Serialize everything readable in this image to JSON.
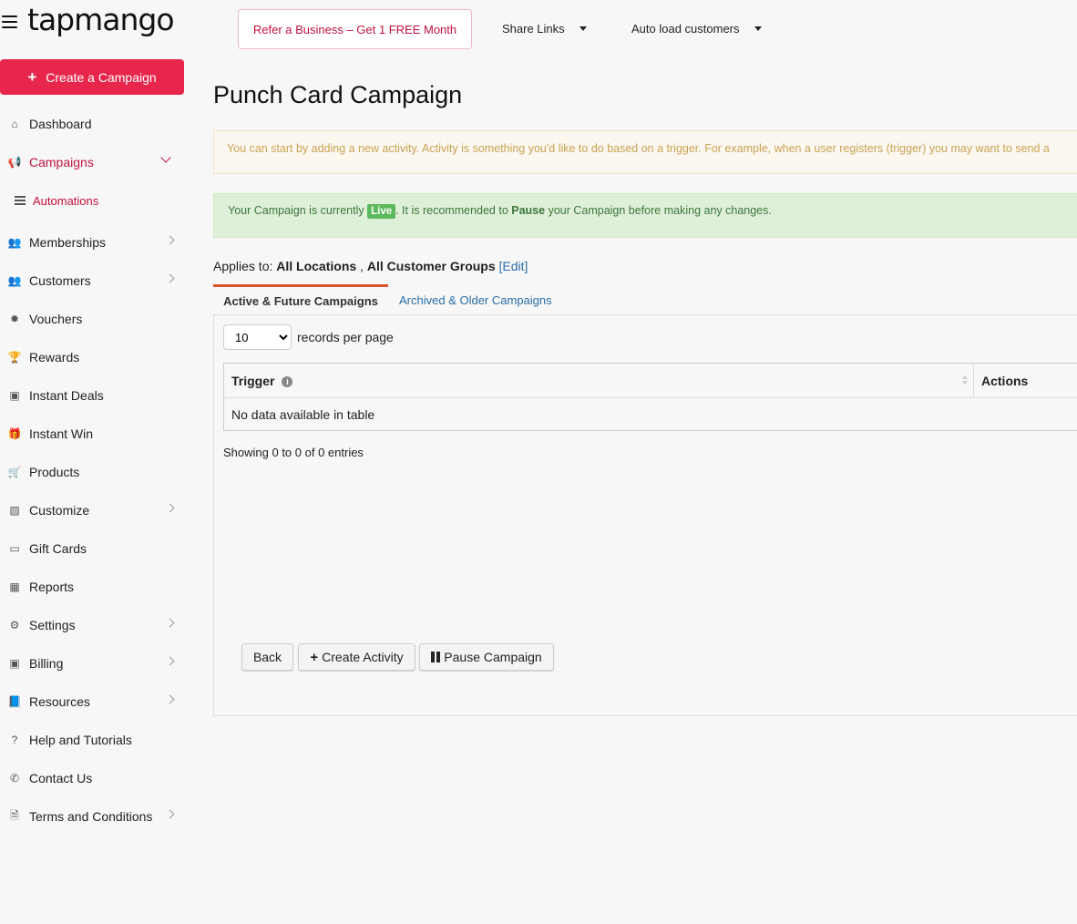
{
  "header": {
    "logo": "tapmango",
    "refer_label": "Refer a Business – Get 1 FREE Month",
    "share_links": "Share Links",
    "auto_load": "Auto load customers"
  },
  "sidebar": {
    "create_label": "Create a Campaign",
    "items": [
      {
        "label": "Dashboard",
        "icon": "home-icon"
      },
      {
        "label": "Campaigns",
        "icon": "megaphone-icon"
      },
      {
        "label": "Memberships",
        "icon": "users-icon"
      },
      {
        "label": "Customers",
        "icon": "users-icon"
      },
      {
        "label": "Vouchers",
        "icon": "badge-icon"
      },
      {
        "label": "Rewards",
        "icon": "trophy-icon"
      },
      {
        "label": "Instant Deals",
        "icon": "money-icon"
      },
      {
        "label": "Instant Win",
        "icon": "gift-icon"
      },
      {
        "label": "Products",
        "icon": "cart-icon"
      },
      {
        "label": "Customize",
        "icon": "image-icon"
      },
      {
        "label": "Gift Cards",
        "icon": "card-icon"
      },
      {
        "label": "Reports",
        "icon": "table-icon"
      },
      {
        "label": "Settings",
        "icon": "gear-icon"
      },
      {
        "label": "Billing",
        "icon": "money-icon"
      },
      {
        "label": "Resources",
        "icon": "book-icon"
      },
      {
        "label": "Help and Tutorials",
        "icon": "question-icon"
      },
      {
        "label": "Contact Us",
        "icon": "phone-icon"
      },
      {
        "label": "Terms and Conditions",
        "icon": "document-icon"
      }
    ],
    "sub_item": "Automations"
  },
  "main": {
    "title": "Punch Card Campaign",
    "info_text": "You can start by adding a new activity. Activity is something you'd like to do based on a trigger. For example, when a user registers (trigger) you may want to send a",
    "live": {
      "prefix": "Your Campaign is currently ",
      "badge": "Live",
      "middle": ". It is recommended to ",
      "bold": "Pause",
      "suffix": " your Campaign before making any changes."
    },
    "applies": {
      "label": "Applies to: ",
      "locations": "All Locations",
      "sep": " , ",
      "groups": "All Customer Groups",
      "edit": "[Edit]"
    },
    "tabs": [
      "Active & Future Campaigns",
      "Archived & Older Campaigns"
    ],
    "per_page_value": "10",
    "per_page_label": "records per page",
    "table": {
      "headers": [
        "Trigger",
        "Actions"
      ],
      "empty": "No data available in table"
    },
    "showing": "Showing 0 to 0 of 0 entries",
    "buttons": {
      "back": "Back",
      "create_activity": "Create Activity",
      "pause": "Pause Campaign"
    }
  },
  "colors": {
    "brand": "#e8264c",
    "accent_text": "#c0123c",
    "link": "#2a6ea6",
    "live_badge": "#5cb85c"
  }
}
